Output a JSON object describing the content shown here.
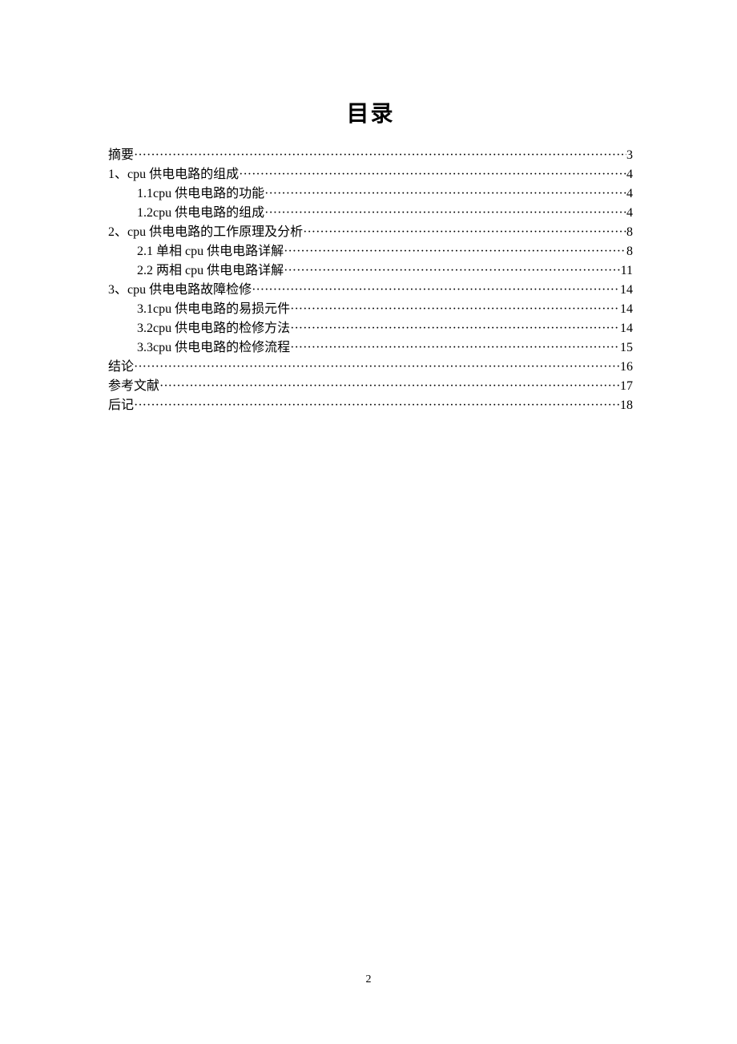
{
  "title": "目录",
  "page_number": "2",
  "entries": [
    {
      "label": "摘要",
      "page": "3",
      "indent": false
    },
    {
      "label": "1、cpu 供电电路的组成",
      "page": "4",
      "indent": false
    },
    {
      "label": "1.1cpu 供电电路的功能",
      "page": "4",
      "indent": true
    },
    {
      "label": "1.2cpu 供电电路的组成",
      "page": " 4",
      "indent": true
    },
    {
      "label": "2、cpu 供电电路的工作原理及分析",
      "page": "8",
      "indent": false
    },
    {
      "label": "2.1 单相 cpu 供电电路详解",
      "page": "8",
      "indent": true
    },
    {
      "label": "2.2 两相 cpu 供电电路详解",
      "page": "11",
      "indent": true
    },
    {
      "label": "3、cpu 供电电路故障检修",
      "page": "14",
      "indent": false
    },
    {
      "label": "3.1cpu 供电电路的易损元件",
      "page": "14",
      "indent": true
    },
    {
      "label": "3.2cpu 供电电路的检修方法",
      "page": "14",
      "indent": true
    },
    {
      "label": "3.3cpu 供电电路的检修流程",
      "page": "15",
      "indent": true
    },
    {
      "label": "结论",
      "page": "16",
      "indent": false
    },
    {
      "label": "参考文献",
      "page": "17",
      "indent": false
    },
    {
      "label": "后记",
      "page": "18",
      "indent": false
    }
  ]
}
